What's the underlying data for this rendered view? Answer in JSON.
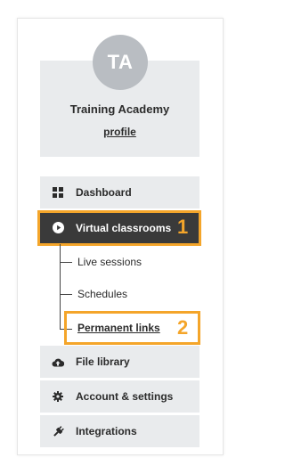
{
  "profile": {
    "initials": "TA",
    "org_name": "Training Academy",
    "profile_link": "profile"
  },
  "nav": {
    "dashboard": "Dashboard",
    "virtual_classrooms": "Virtual classrooms",
    "sub": {
      "live_sessions": "Live sessions",
      "schedules": "Schedules",
      "permanent_links": "Permanent links"
    },
    "file_library": "File library",
    "account_settings": "Account & settings",
    "integrations": "Integrations"
  },
  "annotations": {
    "badge_1": "1",
    "badge_2": "2",
    "highlight_color": "#f4a52a"
  },
  "colors": {
    "active_bg": "#3a3a3a",
    "item_bg": "#e9ebed",
    "avatar_bg": "#b9bdc2"
  }
}
